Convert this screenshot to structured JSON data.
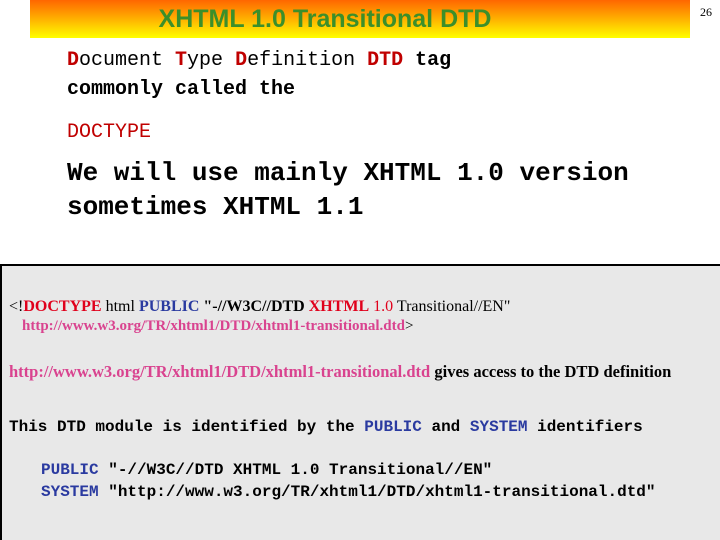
{
  "slide": {
    "title": "XHTML 1.0 Transitional DTD",
    "page_number": "26"
  },
  "intro": {
    "line1": {
      "d_initial": "D",
      "d_rest": "ocument ",
      "t_initial": "T",
      "t_rest": "ype ",
      "d2_initial": "D",
      "d2_rest": "efinition ",
      "acronym": "DTD",
      "tail": " tag"
    },
    "line2": "commonly called the",
    "doctype_word": "DOCTYPE"
  },
  "main_statement": {
    "line1": "We will use mainly XHTML 1.0 version",
    "line2": "sometimes XHTML 1.1"
  },
  "code_box": {
    "doctype_line": {
      "open": "<!",
      "doctype_kw": "DOCTYPE",
      "html": " html ",
      "public_kw": "PUBLIC",
      "quote_start": " \"-//W3C//DTD ",
      "xhtml_kw": "XHTML",
      "space": " ",
      "version": "1.0",
      "trans": " Transitional//EN\""
    },
    "url_line": {
      "url_a": "http://www.w3.org/TR/xhtml1/",
      "url_dtd": "DTD",
      "url_b": "/xhtml1-transitional.dtd",
      "close": ">"
    },
    "access_line": {
      "url": "http://www.w3.org/TR/xhtml1/DTD/xhtml1-transitional.dtd",
      "text_a": " gives access to the ",
      "dtd": "DTD",
      "text_b": " definition"
    },
    "module_line": {
      "a": "This DTD module is identified by the ",
      "public": "PUBLIC",
      "and": " and ",
      "system": "SYSTEM",
      "b": " identifiers"
    },
    "public_line": {
      "kw": "PUBLIC",
      "value": " \"-//W3C//DTD XHTML 1.0 Transitional//EN\""
    },
    "system_line": {
      "kw": "SYSTEM",
      "value": " \"http://www.w3.org/TR/xhtml1/DTD/xhtml1-transitional.dtd\""
    }
  }
}
